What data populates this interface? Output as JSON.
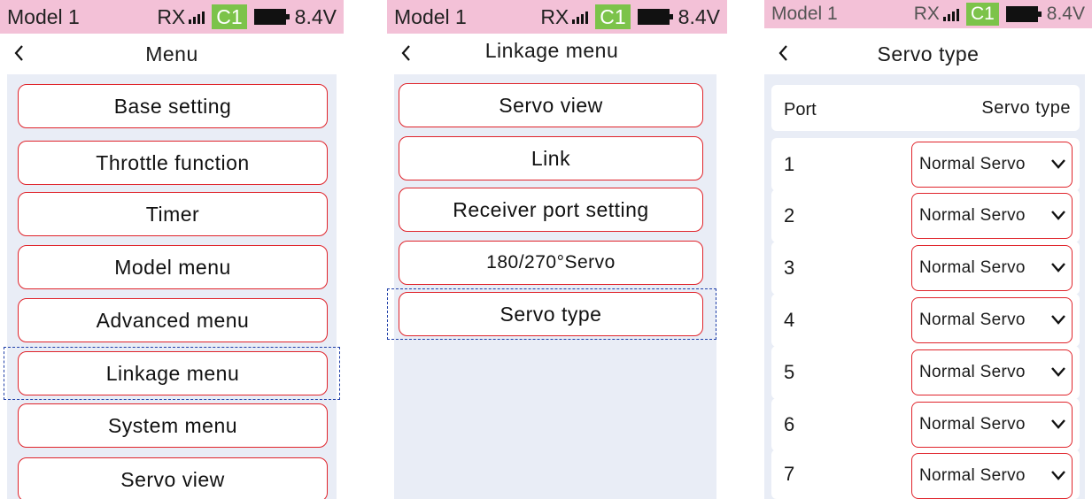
{
  "status": {
    "model": "Model 1",
    "rx": "RX",
    "channel_badge": "C1",
    "voltage": "8.4V"
  },
  "screens": [
    {
      "title": "Menu",
      "items": [
        "Base setting",
        "Throttle function",
        "Timer",
        "Model menu",
        "Advanced menu",
        "Linkage menu",
        "System menu",
        "Servo view"
      ],
      "focused": "Linkage menu"
    },
    {
      "title": "Linkage menu",
      "items": [
        "Servo view",
        "Link",
        "Receiver port setting",
        "180/270°Servo",
        "Servo type"
      ],
      "focused": "Servo type"
    },
    {
      "title": "Servo type",
      "header": {
        "port": "Port",
        "type": "Servo type"
      },
      "rows": [
        {
          "port": "1",
          "value": "Normal Servo"
        },
        {
          "port": "2",
          "value": "Normal Servo"
        },
        {
          "port": "3",
          "value": "Normal Servo"
        },
        {
          "port": "4",
          "value": "Normal Servo"
        },
        {
          "port": "5",
          "value": "Normal Servo"
        },
        {
          "port": "6",
          "value": "Normal Servo"
        },
        {
          "port": "7",
          "value": "Normal Servo"
        }
      ]
    }
  ],
  "colors": {
    "status_bg": "#f3c1d7",
    "badge_green": "#7cc34a",
    "button_border": "#e0242b",
    "focus_dash": "#1f3fa8",
    "panel_bg": "#e9edf6"
  },
  "icons": {
    "back": "chevron-left-icon",
    "dropdown": "chevron-down-icon",
    "signal": "signal-bars-icon",
    "battery": "battery-icon"
  }
}
